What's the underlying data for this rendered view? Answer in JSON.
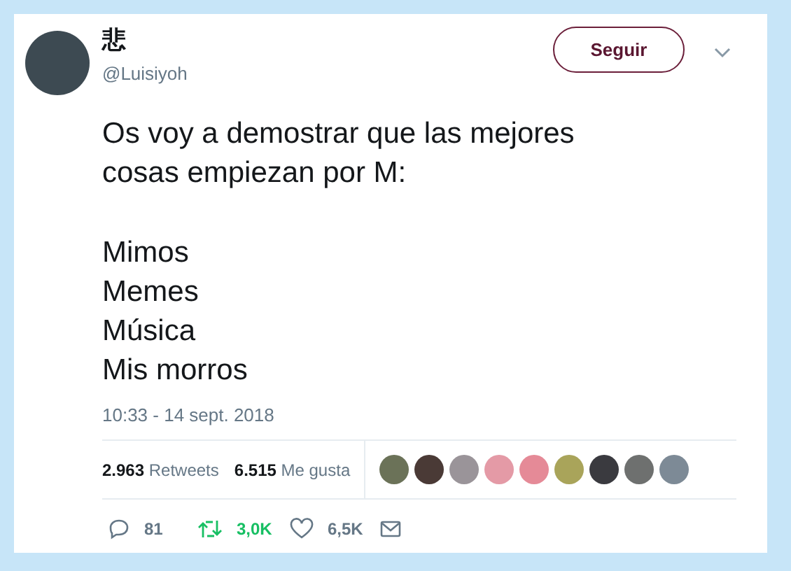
{
  "author": {
    "name": "悲",
    "handle": "@Luisiyoh"
  },
  "follow_button": "Seguir",
  "tweet": {
    "paragraphs": [
      [
        "Os voy a demostrar que las mejores",
        "cosas empiezan por M:"
      ],
      [
        "Mimos",
        "Memes",
        "Música",
        "Mis morros"
      ]
    ]
  },
  "timestamp": "10:33 - 14 sept. 2018",
  "stats": [
    {
      "count": "2.963",
      "label": "Retweets"
    },
    {
      "count": "6.515",
      "label": "Me gusta"
    }
  ],
  "likers": [
    {
      "color": "#6b7258"
    },
    {
      "color": "#4a3a36"
    },
    {
      "color": "#9a9499"
    },
    {
      "color": "#e49aa6"
    },
    {
      "color": "#e58a97"
    },
    {
      "color": "#a9a45a"
    },
    {
      "color": "#3a3a3f"
    },
    {
      "color": "#6e706f"
    },
    {
      "color": "#7d8a96"
    }
  ],
  "actions": [
    {
      "kind": "reply",
      "count": "81",
      "active": false
    },
    {
      "kind": "retweet",
      "count": "3,0K",
      "active": true
    },
    {
      "kind": "like",
      "count": "6,5K",
      "active": false
    },
    {
      "kind": "message",
      "active": false
    }
  ]
}
